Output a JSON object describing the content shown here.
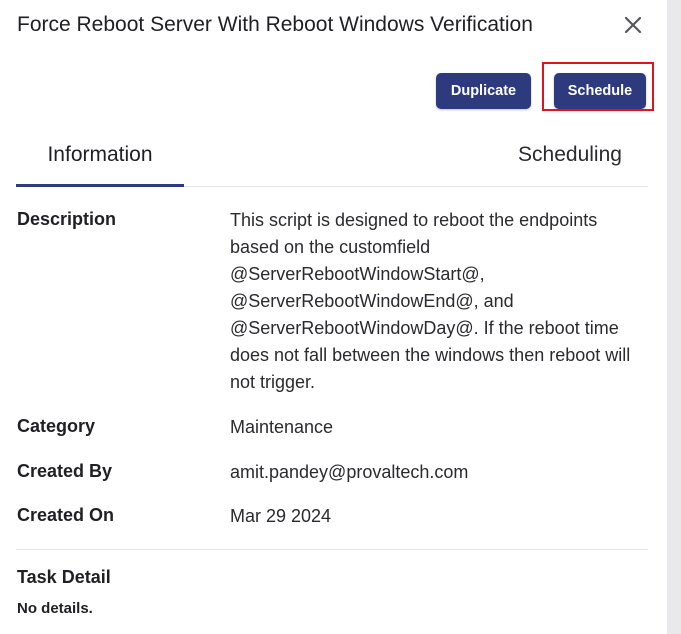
{
  "dialog": {
    "title": "Force Reboot Server With Reboot Windows Verification",
    "close_icon": "close-x-icon"
  },
  "actions": {
    "duplicate_label": "Duplicate",
    "schedule_label": "Schedule"
  },
  "tabs": [
    {
      "label": "Information",
      "active": true
    },
    {
      "label": "Scheduling",
      "active": false
    }
  ],
  "info": {
    "description_label": "Description",
    "description_value": "This script is designed to reboot the endpoints based on the customfield @ServerRebootWindowStart@, @ServerRebootWindowEnd@, and @ServerRebootWindowDay@. If the reboot time does not fall between the windows then reboot will not trigger.",
    "category_label": "Category",
    "category_value": "Maintenance",
    "created_by_label": "Created By",
    "created_by_value": "amit.pandey@provaltech.com",
    "created_on_label": "Created On",
    "created_on_value": "Mar 29 2024"
  },
  "task": {
    "title": "Task Detail",
    "detail": "No details."
  },
  "colors": {
    "primary": "#2d3a7d",
    "highlight": "#e1141d"
  }
}
